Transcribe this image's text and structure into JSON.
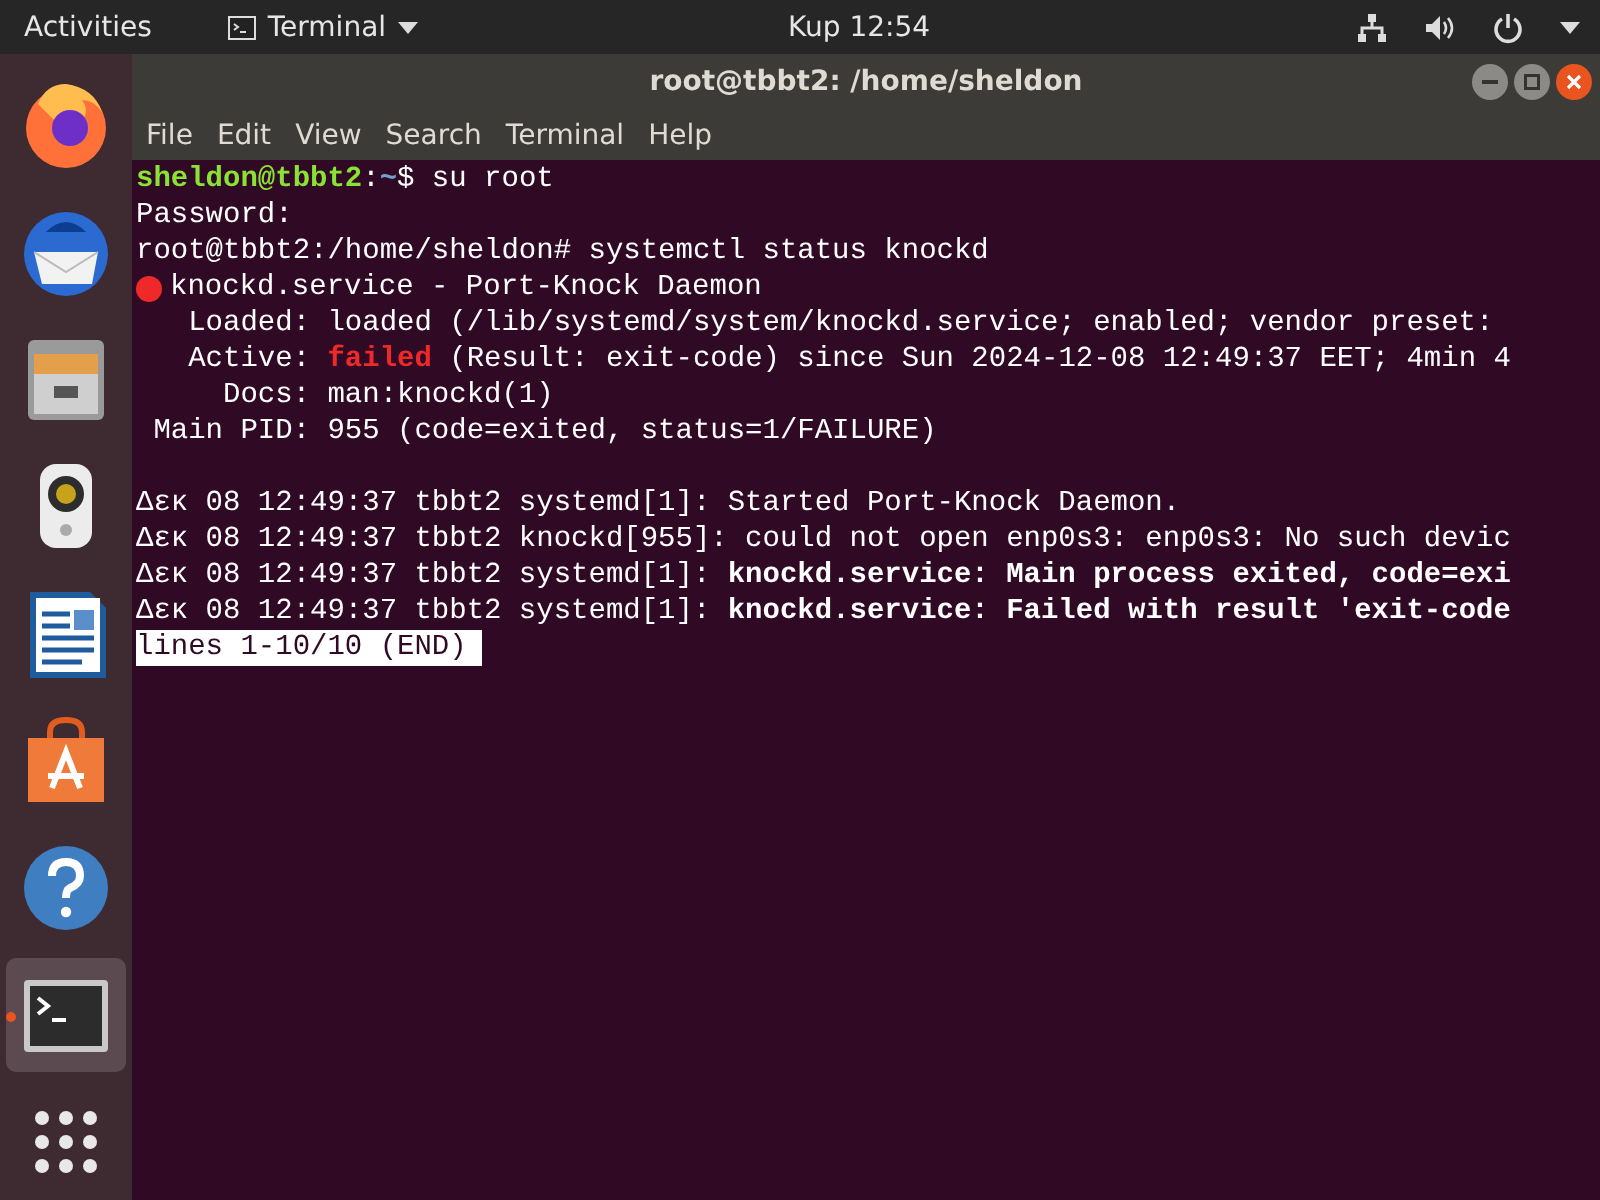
{
  "top_bar": {
    "activities": "Activities",
    "app_menu": "Terminal",
    "clock": "Kup 12:54"
  },
  "dock": [
    {
      "kind": "firefox",
      "selected": false,
      "running": false
    },
    {
      "kind": "mail",
      "selected": false,
      "running": false
    },
    {
      "kind": "files",
      "selected": false,
      "running": false
    },
    {
      "kind": "music",
      "selected": false,
      "running": false
    },
    {
      "kind": "writer",
      "selected": false,
      "running": false
    },
    {
      "kind": "store",
      "selected": false,
      "running": false
    },
    {
      "kind": "help",
      "selected": false,
      "running": false
    },
    {
      "kind": "terminal",
      "selected": true,
      "running": true
    },
    {
      "kind": "apps",
      "selected": false,
      "running": false
    }
  ],
  "window": {
    "title": "root@tbbt2: /home/sheldon",
    "menu": [
      "File",
      "Edit",
      "View",
      "Search",
      "Terminal",
      "Help"
    ]
  },
  "terminal": {
    "lines": [
      {
        "kind": "text",
        "segments": [
          {
            "kind": "user",
            "text": "sheldon@tbbt2"
          },
          {
            "kind": "plain",
            "text": ":"
          },
          {
            "kind": "path",
            "text": "~"
          },
          {
            "kind": "plain",
            "text": "$ su root"
          }
        ]
      },
      {
        "kind": "text",
        "segments": [
          {
            "kind": "plain",
            "text": "Password:"
          }
        ]
      },
      {
        "kind": "text",
        "segments": [
          {
            "kind": "plain",
            "text": "root@tbbt2:/home/sheldon# systemctl status knockd"
          }
        ]
      },
      {
        "kind": "status",
        "segments": [
          {
            "kind": "plain",
            "text": "knockd.service - Port-Knock Daemon"
          }
        ]
      },
      {
        "kind": "text",
        "segments": [
          {
            "kind": "plain",
            "text": "   Loaded: loaded (/lib/systemd/system/knockd.service; enabled; vendor preset:"
          }
        ]
      },
      {
        "kind": "text",
        "segments": [
          {
            "kind": "plain",
            "text": "   Active: "
          },
          {
            "kind": "failed",
            "text": "failed"
          },
          {
            "kind": "plain",
            "text": " (Result: exit-code) since Sun 2024-12-08 12:49:37 EET; 4min 4"
          }
        ]
      },
      {
        "kind": "text",
        "segments": [
          {
            "kind": "plain",
            "text": "     Docs: man:knockd(1)"
          }
        ]
      },
      {
        "kind": "text",
        "segments": [
          {
            "kind": "plain",
            "text": " Main PID: 955 (code=exited, status=1/FAILURE)"
          }
        ]
      },
      {
        "kind": "blank"
      },
      {
        "kind": "text",
        "segments": [
          {
            "kind": "plain",
            "text": "Δεκ 08 12:49:37 tbbt2 systemd[1]: Started Port-Knock Daemon."
          }
        ]
      },
      {
        "kind": "text",
        "segments": [
          {
            "kind": "plain",
            "text": "Δεκ 08 12:49:37 tbbt2 knockd[955]: could not open enp0s3: enp0s3: No such devic"
          }
        ]
      },
      {
        "kind": "text",
        "segments": [
          {
            "kind": "plain",
            "text": "Δεκ 08 12:49:37 tbbt2 systemd[1]: "
          },
          {
            "kind": "bold",
            "text": "knockd.service: Main process exited, code=exi"
          }
        ]
      },
      {
        "kind": "text",
        "segments": [
          {
            "kind": "plain",
            "text": "Δεκ 08 12:49:37 tbbt2 systemd[1]: "
          },
          {
            "kind": "bold",
            "text": "knockd.service: Failed with result 'exit-code"
          }
        ]
      }
    ],
    "pager_status": "lines 1-10/10 (END)"
  }
}
